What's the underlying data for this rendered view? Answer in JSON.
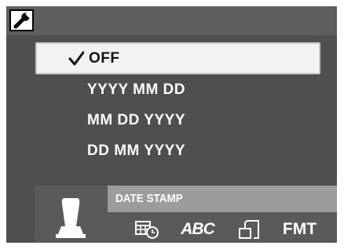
{
  "screen": {
    "header_icon": "wrench-icon"
  },
  "menu": {
    "items": [
      {
        "label": "OFF",
        "selected": true
      },
      {
        "label": "YYYY MM DD",
        "selected": false
      },
      {
        "label": "MM DD YYYY",
        "selected": false
      },
      {
        "label": "DD MM YYYY",
        "selected": false
      }
    ]
  },
  "dock": {
    "current_label": "DATE STAMP",
    "current_icon": "date-stamp-icon",
    "tabs": [
      {
        "icon": "calendar-clock-icon",
        "label": ""
      },
      {
        "icon": "abc-text-icon",
        "label": "ABC"
      },
      {
        "icon": "rotate-icon",
        "label": ""
      },
      {
        "icon": "format-icon",
        "label": "FMT"
      }
    ]
  },
  "colors": {
    "screen_bg": "#4f4f4f",
    "selected_bg": "#f2f2f2",
    "label_bar": "#9c9c9c"
  }
}
